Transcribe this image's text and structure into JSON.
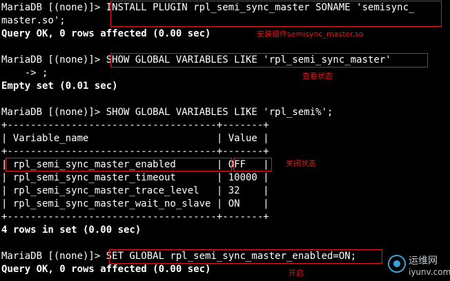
{
  "terminal": {
    "lines": [
      {
        "text": "MariaDB [(none)]> INSTALL PLUGIN rpl_semi_sync_master SONAME 'semisync_",
        "bold": false
      },
      {
        "text": "master.so';",
        "bold": false
      },
      {
        "text": "Query OK, 0 rows affected (0.00 sec)",
        "bold": true
      },
      {
        "text": "",
        "bold": false
      },
      {
        "text": "MariaDB [(none)]> SHOW GLOBAL VARIABLES LIKE 'rpl_semi_sync_master'",
        "bold": false
      },
      {
        "text": "    -> ;",
        "bold": false
      },
      {
        "text": "Empty set (0.01 sec)",
        "bold": true
      },
      {
        "text": "",
        "bold": false
      },
      {
        "text": "MariaDB [(none)]> SHOW GLOBAL VARIABLES LIKE 'rpl_semi%';",
        "bold": false
      },
      {
        "text": "+------------------------------------+-------+",
        "bold": false
      },
      {
        "text": "| Variable_name                      | Value |",
        "bold": false
      },
      {
        "text": "+------------------------------------+-------+",
        "bold": false
      },
      {
        "text": "| rpl_semi_sync_master_enabled       | OFF   |",
        "bold": false
      },
      {
        "text": "| rpl_semi_sync_master_timeout       | 10000 |",
        "bold": false
      },
      {
        "text": "| rpl_semi_sync_master_trace_level   | 32    |",
        "bold": false
      },
      {
        "text": "| rpl_semi_sync_master_wait_no_slave | ON    |",
        "bold": false
      },
      {
        "text": "+------------------------------------+-------+",
        "bold": false
      },
      {
        "text": "4 rows in set (0.00 sec)",
        "bold": true
      },
      {
        "text": "",
        "bold": false
      },
      {
        "text": "MariaDB [(none)]> SET GLOBAL rpl_semi_sync_master_enabled=ON;",
        "bold": false
      },
      {
        "text": "Query OK, 0 rows affected (0.00 sec)",
        "bold": true
      }
    ]
  },
  "annotations": {
    "install": "安装插件semisync_master.so",
    "check_status": "查看状态",
    "off_status": "关闭状态",
    "enable": "开启"
  },
  "watermark": {
    "name": "运维网",
    "domain": "iyunv.com"
  },
  "colors": {
    "background": "#000000",
    "text": "#ffffff",
    "annotation": "#e8141b",
    "watermark_accent": "#3aa3d8"
  }
}
